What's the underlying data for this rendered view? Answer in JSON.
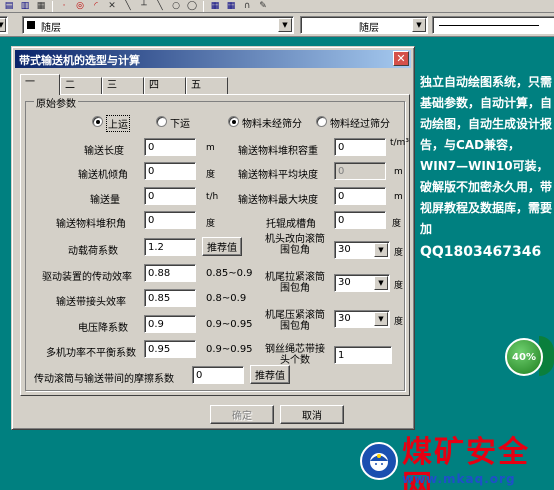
{
  "toolbar": {
    "icons": [
      "open-icon",
      "save-icon",
      "print-icon",
      "point-icon",
      "circle-icon",
      "arc-icon",
      "line-icon",
      "polyline-icon",
      "angle-icon",
      "ray-icon",
      "ellipse-icon",
      "circle2-icon",
      "grid-icon",
      "block-icon",
      "magnet-icon",
      "pencil-icon"
    ]
  },
  "layer_bar": {
    "layer_name": "随层",
    "linetype_name": "随层"
  },
  "dialog": {
    "title": "带式输送机的选型与计算",
    "close_symbol": "✕",
    "tabs": [
      "一",
      "二",
      "三",
      "四",
      "五"
    ],
    "group_title": "原始参数",
    "radios": {
      "up_label": "上运",
      "down_label": "下运",
      "unscreened_label": "物料未经筛分",
      "screened_label": "物料经过筛分"
    },
    "fields": {
      "length_label": "输送长度",
      "length_value": "0",
      "length_unit": "m",
      "angle_label": "输送机倾角",
      "angle_value": "0",
      "angle_unit": "度",
      "capacity_label": "输送量",
      "capacity_value": "0",
      "capacity_unit": "t/h",
      "repose_label": "输送物料堆积角",
      "repose_value": "0",
      "repose_unit": "度",
      "dynamic_label": "动载荷系数",
      "dynamic_value": "1.2",
      "dynamic_btn": "推荐值",
      "drive_eff_label": "驱动装置的传动效率",
      "drive_eff_value": "0.88",
      "drive_eff_note": "0.85~0.9",
      "bend_eff_label": "输送带接头效率",
      "bend_eff_value": "0.85",
      "bend_eff_note": "0.8~0.9",
      "voltage_label": "电压降系数",
      "voltage_value": "0.9",
      "voltage_note": "0.9~0.95",
      "unbalance_label": "多机功率不平衡系数",
      "unbalance_value": "0.95",
      "unbalance_note": "0.9~0.95",
      "friction_label": "传动滚筒与输送带间的摩擦系数",
      "friction_value": "0",
      "friction_btn": "推荐值",
      "density_label": "输送物料堆积容重",
      "density_value": "0",
      "density_unit": "t/m³",
      "avg_size_label": "输送物料平均块度",
      "avg_size_value": "0",
      "avg_size_unit": "m",
      "max_size_label": "输送物料最大块度",
      "max_size_value": "0",
      "max_size_unit": "m",
      "trough_label": "托辊成槽角",
      "trough_value": "0",
      "trough_unit": "度",
      "diverter_label": "机头改向滚筒围包角",
      "diverter_value": "30",
      "diverter_unit": "度",
      "tail_label": "机尾拉紧滚筒围包角",
      "tail_value": "30",
      "tail_unit": "度",
      "tail_tension_label": "机尾压紧滚筒围包角",
      "tail_tension_value": "30",
      "tail_tension_unit": "度",
      "joints_label": "钢丝绳芯带接头个数",
      "joints_value": "1"
    },
    "ok_label": "确定",
    "cancel_label": "取消"
  },
  "ad": {
    "text": "独立自动绘图系统，只需基础参数，自动计算，自动绘图，自动生成设计报告，与CAD兼容，WIN7—WIN10可装，破解版不加密永久用，带视屏教程及数据库，需要加",
    "qq": "QQ1803467346"
  },
  "badge": {
    "percent_label": "40%",
    "percent_value": 40
  },
  "watermark": {
    "title": "煤矿安全网",
    "url": "www.mkaq.org"
  },
  "colors": {
    "desktop": "#008080",
    "title_active": "#0a246a",
    "ad_text": "#ffffff",
    "watermark_red": "#e60012",
    "watermark_blue": "#1e50c8"
  }
}
